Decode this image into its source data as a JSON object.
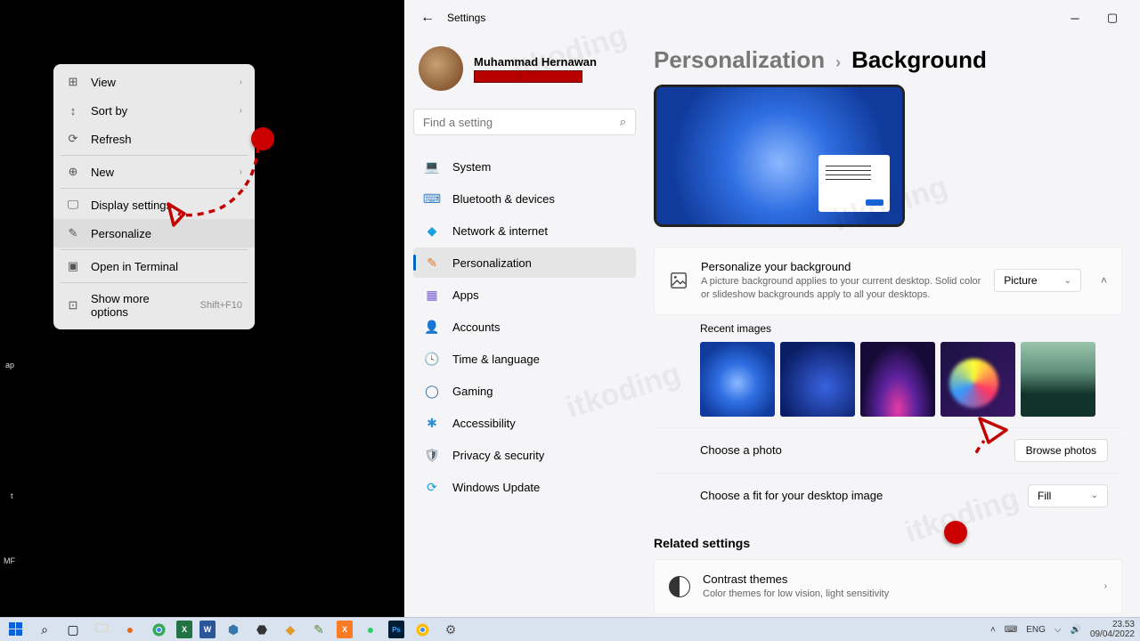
{
  "app": {
    "title": "Settings"
  },
  "profile": {
    "name": "Muhammad Hernawan"
  },
  "search": {
    "placeholder": "Find a setting"
  },
  "sidebar": {
    "items": [
      {
        "label": "System",
        "icon": "💻",
        "color": "#3b82c4"
      },
      {
        "label": "Bluetooth & devices",
        "icon": "⌨",
        "color": "#3b82c4"
      },
      {
        "label": "Network & internet",
        "icon": "◆",
        "color": "#1aa0e0"
      },
      {
        "label": "Personalization",
        "icon": "✎",
        "color": "#e07a2c"
      },
      {
        "label": "Apps",
        "icon": "▦",
        "color": "#7a5fcf"
      },
      {
        "label": "Accounts",
        "icon": "👤",
        "color": "#3b82c4"
      },
      {
        "label": "Time & language",
        "icon": "🕓",
        "color": "#e0953a"
      },
      {
        "label": "Gaming",
        "icon": "◯",
        "color": "#2d6fa0"
      },
      {
        "label": "Accessibility",
        "icon": "✱",
        "color": "#2f8fd0"
      },
      {
        "label": "Privacy & security",
        "icon": "🛡",
        "color": "#5a6b7a"
      },
      {
        "label": "Windows Update",
        "icon": "⟳",
        "color": "#1aa0e0"
      }
    ]
  },
  "breadcrumb": {
    "parent": "Personalization",
    "sep": "›",
    "current": "Background"
  },
  "personalize_card": {
    "title": "Personalize your background",
    "desc": "A picture background applies to your current desktop. Solid color or slideshow backgrounds apply to all your desktops.",
    "dropdown": "Picture"
  },
  "recent": {
    "label": "Recent images"
  },
  "choose_photo": {
    "label": "Choose a photo",
    "button": "Browse photos"
  },
  "fit": {
    "label": "Choose a fit for your desktop image",
    "dropdown": "Fill"
  },
  "related": {
    "heading": "Related settings"
  },
  "contrast": {
    "title": "Contrast themes",
    "desc": "Color themes for low vision, light sensitivity"
  },
  "context_menu": {
    "items": [
      {
        "label": "View",
        "icon": "⊞",
        "sub": true
      },
      {
        "label": "Sort by",
        "icon": "↕",
        "sub": true
      },
      {
        "label": "Refresh",
        "icon": "⟳"
      },
      {
        "label": "New",
        "icon": "⊕",
        "sub": true,
        "divider_before": true
      },
      {
        "label": "Display settings",
        "icon": "🖵",
        "divider_before": true
      },
      {
        "label": "Personalize",
        "icon": "✎",
        "hl": true
      },
      {
        "label": "Open in Terminal",
        "icon": "▣",
        "divider_before": true
      },
      {
        "label": "Show more options",
        "icon": "⊡",
        "shortcut": "Shift+F10",
        "divider_before": true
      }
    ]
  },
  "taskbar": {
    "icons": [
      "start",
      "search",
      "taskview",
      "explorer",
      "firefox",
      "chrome",
      "excel",
      "word",
      "python",
      "unity",
      "sublime",
      "gimp",
      "xampp",
      "whatsapp",
      "photoshop",
      "chrome-canary",
      "settings"
    ],
    "lang_code": "ENG",
    "lang_sym": "⌨",
    "tray_up": "˄",
    "time": "23.53",
    "date": "09/04/2022"
  },
  "desktop_labels": {
    "a": "ap",
    "b": "t",
    "c": "MF"
  },
  "watermark": "itkoding"
}
